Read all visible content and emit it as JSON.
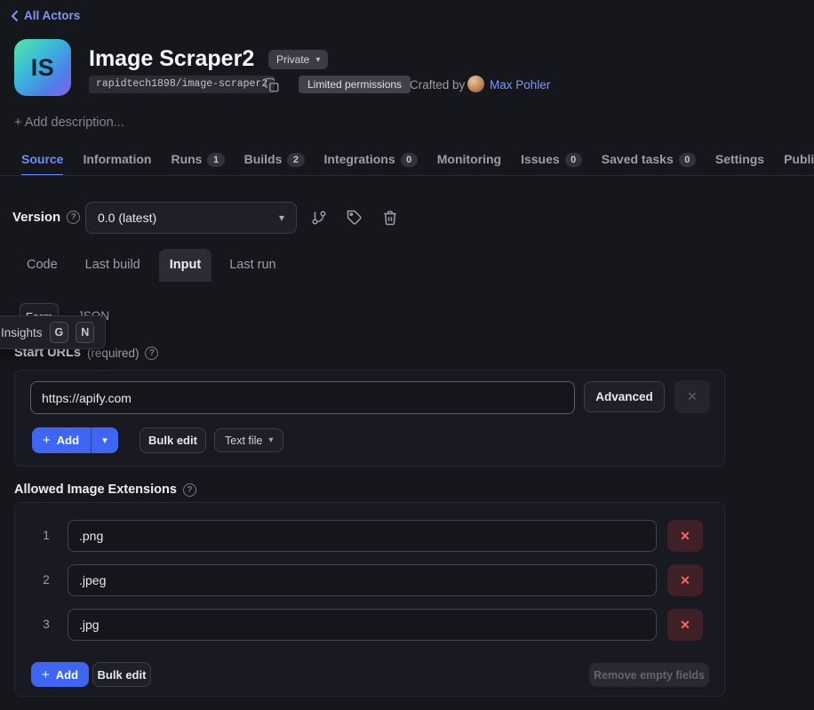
{
  "colors": {
    "accent_blue": "#3e66f3",
    "link_blue": "#7e96f7",
    "danger_red": "#ff6464",
    "active_tab": "#6d8bff"
  },
  "icons": {
    "chevron_down": "▾",
    "plus": "+",
    "close": "✕",
    "help": "?"
  },
  "breadcrumb": {
    "back_label": "All Actors"
  },
  "header": {
    "initials": "IS",
    "title": "Image Scraper2",
    "visibility_label": "Private",
    "repo_path": "rapidtech1898/image-scraper2",
    "permissions_badge": "Limited permissions",
    "crafted_by_label": "Crafted by",
    "author_name": "Max Pohler",
    "add_description_label": "+ Add description..."
  },
  "tabs": [
    {
      "label": "Source"
    },
    {
      "label": "Information"
    },
    {
      "label": "Runs",
      "count": "1"
    },
    {
      "label": "Builds",
      "count": "2"
    },
    {
      "label": "Integrations",
      "count": "0"
    },
    {
      "label": "Monitoring"
    },
    {
      "label": "Issues",
      "count": "0"
    },
    {
      "label": "Saved tasks",
      "count": "0"
    },
    {
      "label": "Settings"
    },
    {
      "label": "Publication"
    }
  ],
  "version_bar": {
    "label": "Version",
    "selected_version": "0.0 (latest)"
  },
  "subtabs": [
    {
      "label": "Code"
    },
    {
      "label": "Last build"
    },
    {
      "label": "Input"
    },
    {
      "label": "Last run"
    }
  ],
  "editor_tabs": {
    "form_label": "Form",
    "json_label": "JSON"
  },
  "insights_popup": {
    "label": "Insights",
    "keys": [
      "G",
      "N"
    ]
  },
  "start_urls": {
    "label": "Start URLs",
    "required_label": "(required)",
    "url_value": "https://apify.com",
    "advanced_button": "Advanced",
    "add_button": "Add",
    "bulk_edit_button": "Bulk edit",
    "text_file_button": "Text file"
  },
  "allowed_extensions": {
    "label": "Allowed Image Extensions",
    "items": [
      {
        "index": "1",
        "value": ".png"
      },
      {
        "index": "2",
        "value": ".jpeg"
      },
      {
        "index": "3",
        "value": ".jpg"
      }
    ],
    "add_button": "Add",
    "bulk_edit_button": "Bulk edit",
    "remove_empty_button": "Remove empty fields"
  }
}
